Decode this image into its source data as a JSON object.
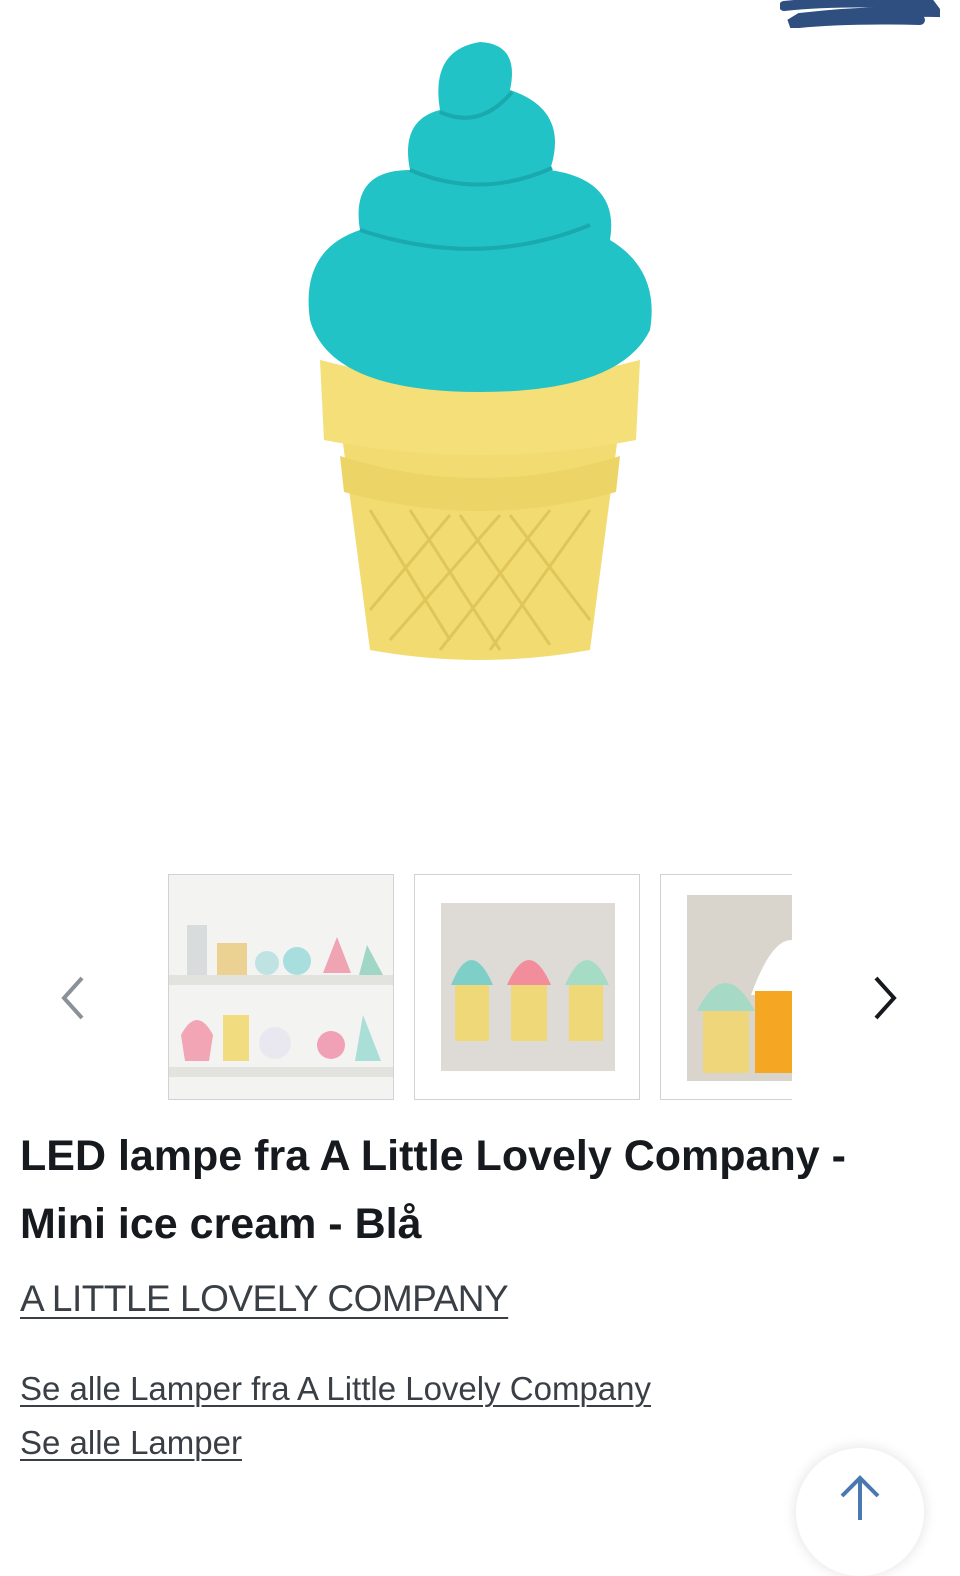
{
  "product": {
    "title": "LED lampe fra A Little Lovely Company - Mini ice cream - Blå",
    "brand": "A LITTLE LOVELY COMPANY",
    "links": [
      "Se alle Lamper fra A Little Lovely Company",
      "Se alle Lamper"
    ]
  },
  "gallery": {
    "main_image": "ice-cream-lamp-blue",
    "thumbnails": [
      "shelf-lamps-photo",
      "three-ice-cream-lamps-photo",
      "ice-cream-lamps-closeup-photo"
    ],
    "prev_icon": "chevron-left-icon",
    "next_icon": "chevron-right-icon"
  },
  "colors": {
    "scoop": "#22c3c6",
    "cone": "#f2dc72",
    "text": "#16191d",
    "link": "#3a3f45",
    "scroll_arrow": "#4a78b0"
  },
  "scroll_top_icon": "arrow-up-icon"
}
